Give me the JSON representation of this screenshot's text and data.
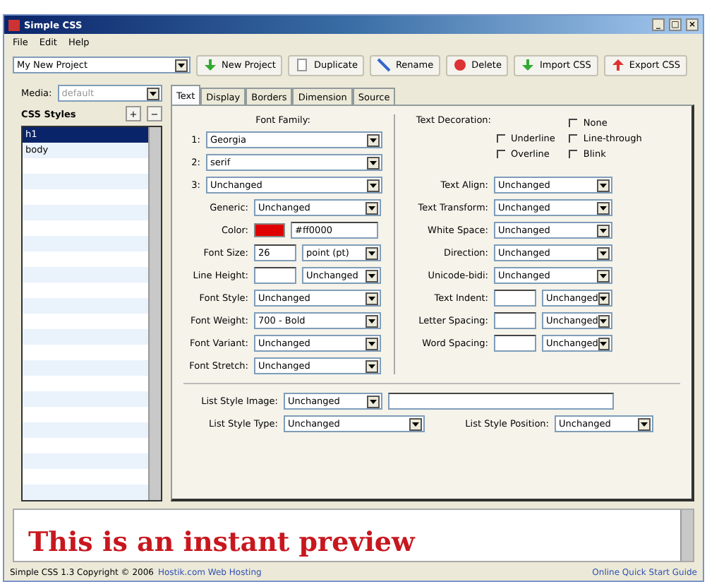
{
  "window": {
    "title": "Simple CSS",
    "controls": [
      "_",
      "□",
      "×"
    ]
  },
  "menu": [
    "File",
    "Edit",
    "Help"
  ],
  "toolbar": {
    "project": "My New Project",
    "buttons": [
      {
        "label": "New Project",
        "kind": "new"
      },
      {
        "label": "Duplicate",
        "kind": "duplicate"
      },
      {
        "label": "Rename",
        "kind": "rename"
      },
      {
        "label": "Delete",
        "kind": "delete"
      },
      {
        "label": "Import CSS",
        "kind": "import"
      },
      {
        "label": "Export CSS",
        "kind": "export"
      }
    ]
  },
  "sidebar": {
    "media_label": "Media:",
    "media_value": "default",
    "styles_label": "CSS Styles",
    "add": "+",
    "remove": "−",
    "items": [
      {
        "label": "h1",
        "selected": true
      },
      {
        "label": "body",
        "selected": false
      }
    ]
  },
  "tabs": [
    {
      "label": "Text",
      "selected": true
    },
    {
      "label": "Display",
      "selected": false
    },
    {
      "label": "Borders",
      "selected": false
    },
    {
      "label": "Dimension",
      "selected": false
    },
    {
      "label": "Source",
      "selected": false
    }
  ],
  "font": {
    "family_label": "Font Family:",
    "families": [
      {
        "number": "1:",
        "value": "Georgia"
      },
      {
        "number": "2:",
        "value": "serif"
      },
      {
        "number": "3:",
        "value": "Unchanged"
      }
    ],
    "fields": [
      {
        "label": "Generic:",
        "kind": "select",
        "value": "Unchanged"
      },
      {
        "label": "Color:",
        "kind": "color",
        "color": "#e00000",
        "value": "#ff0000"
      },
      {
        "label": "Font Size:",
        "kind": "size",
        "value": "26",
        "unit": "point (pt)"
      },
      {
        "label": "Line Height:",
        "kind": "unit",
        "unit": "Unchanged"
      },
      {
        "label": "Font Style:",
        "kind": "select",
        "value": "Unchanged"
      },
      {
        "label": "Font Weight:",
        "kind": "select",
        "value": "700 - Bold"
      },
      {
        "label": "Font Variant:",
        "kind": "select",
        "value": "Unchanged"
      },
      {
        "label": "Font Stretch:",
        "kind": "select",
        "value": "Unchanged"
      }
    ]
  },
  "text": {
    "decoration_label": "Text Decoration:",
    "decorations": [
      {
        "label": "None",
        "checked": false
      },
      {
        "label": "Underline",
        "checked": false
      },
      {
        "label": "Line-through",
        "checked": false
      },
      {
        "label": "Overline",
        "checked": false
      },
      {
        "label": "Blink",
        "checked": false
      }
    ],
    "fields": [
      {
        "label": "Text Align:",
        "kind": "select",
        "value": "Unchanged"
      },
      {
        "label": "Text Transform:",
        "kind": "select",
        "value": "Unchanged"
      },
      {
        "label": "White Space:",
        "kind": "select",
        "value": "Unchanged"
      },
      {
        "label": "Direction:",
        "kind": "select",
        "value": "Unchanged"
      },
      {
        "label": "Unicode-bidi:",
        "kind": "select",
        "value": "Unchanged"
      },
      {
        "label": "Text Indent:",
        "kind": "unit",
        "unit": "Unchanged"
      },
      {
        "label": "Letter Spacing:",
        "kind": "unit",
        "unit": "Unchanged"
      },
      {
        "label": "Word Spacing:",
        "kind": "unit",
        "unit": "Unchanged"
      }
    ]
  },
  "list": {
    "image_label": "List Style Image:",
    "image_value": "Unchanged",
    "type_label": "List Style Type:",
    "type_value": "Unchanged",
    "position_label": "List Style Position:",
    "position_value": "Unchanged"
  },
  "preview": {
    "text": "This is an instant preview"
  },
  "status_bar": {
    "left": "Simple CSS 1.3 Copyright © 2006",
    "link": "Hostik.com Web Hosting",
    "right": "Online Quick Start Guide"
  }
}
